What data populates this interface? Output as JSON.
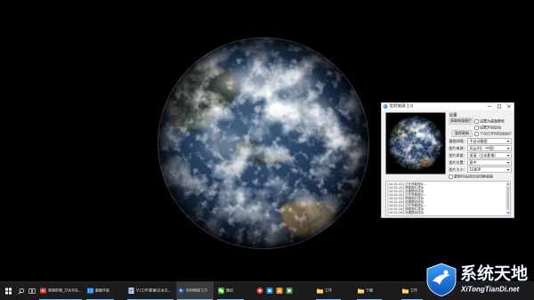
{
  "desktop": {
    "background": "#000000"
  },
  "app_window": {
    "title": "实时地球 2.0",
    "settings_label": "设置",
    "fetch_button": "获取地球图片",
    "pause_button": "暂停更新",
    "checkboxes": [
      {
        "label": "设置为桌面壁纸",
        "checked": false
      },
      {
        "label": "设置开机启动",
        "checked": false
      },
      {
        "label": "下次打开时自动运行",
        "checked": false
      }
    ],
    "fields": [
      {
        "label": "截图间隔：",
        "value": "不自动截图"
      },
      {
        "label": "图片来源：",
        "value": "风云4号（中国）"
      },
      {
        "label": "图片质量：",
        "value": "高清（日本影像）"
      },
      {
        "label": "图片位置：",
        "value": "居中"
      },
      {
        "label": "图片大小：",
        "value": "1080P"
      }
    ],
    "auto_switch_checkbox": {
      "label": "更新时关闭自动切换桌面",
      "checked": false
    },
    "log_lines": [
      "[10:31:22] 正在获取图片...",
      "[10:31:25] 获取图片成功",
      "[10:31:25] 设置壁纸成功",
      "[10:41:22] 正在获取图片...",
      "[10:41:24] 获取图片成功",
      "[10:41:24] 设置壁纸成功",
      "[10:51:22] 正在获取图片...",
      "[10:51:26] 获取图片成功",
      "[10:51:26] 设置壁纸成功"
    ]
  },
  "taskbar": {
    "start_icon": "windows-logo-icon",
    "search_icon": "search-icon",
    "task_view_icon": "task-view-icon",
    "tasks": [
      {
        "label": "视频剪辑_方块书名...",
        "icon": "video-editor-icon",
        "active": false
      },
      {
        "label": "截图平板",
        "icon": "screenshot-icon",
        "active": false
      },
      {
        "label": "V:\\工作\\影像\\文本文...",
        "icon": "notepad-icon",
        "active": false
      },
      {
        "label": "实时地球 2.0",
        "icon": "earth-app-icon",
        "active": true
      },
      {
        "label": "微信",
        "icon": "wechat-icon",
        "active": false
      },
      {
        "label": "工作",
        "icon": "folder-icon",
        "active": false
      },
      {
        "label": "下载",
        "icon": "folder-icon",
        "active": false
      },
      {
        "label": "工作",
        "icon": "folder-icon",
        "active": false
      }
    ],
    "pinned_icons": [
      "app-red-icon",
      "app-blue-icon",
      "app-orange-icon",
      "app-green-icon"
    ],
    "accent": "#76b9ed"
  },
  "watermark": {
    "title": "系统天地",
    "url": "XiTongTianDi.net",
    "logo_icon": "xitongtiandi-logo-icon"
  }
}
